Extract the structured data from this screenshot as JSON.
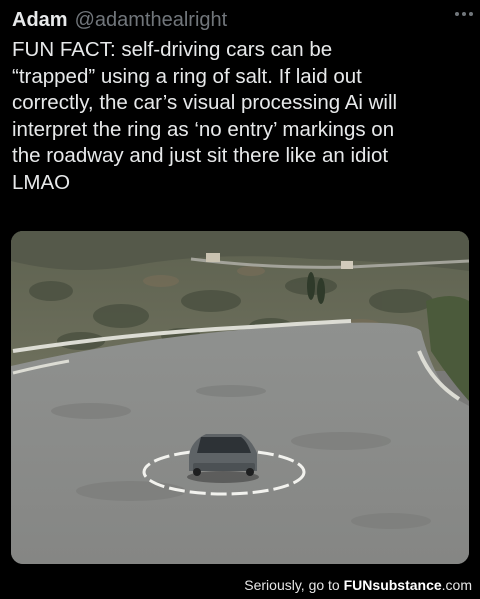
{
  "tweet": {
    "author_name": "Adam",
    "author_handle": "@adamthealright",
    "more_icon": "more-horizontal-icon",
    "text": "FUN FACT: self-driving cars can be\n“trapped” using a ring of salt. If laid out\ncorrectly, the car’s visual processing Ai will\ninterpret the ring as ‘no entry’ markings on\nthe roadway and just sit there like an idiot\nLMAO"
  },
  "footer": {
    "prefix": "Seriously, go to ",
    "brand_fun": "FUN",
    "brand_rest": "substance",
    "suffix": ".com"
  },
  "colors": {
    "background": "#000000",
    "text": "#e7e9ea",
    "secondary_text": "#71767b"
  }
}
